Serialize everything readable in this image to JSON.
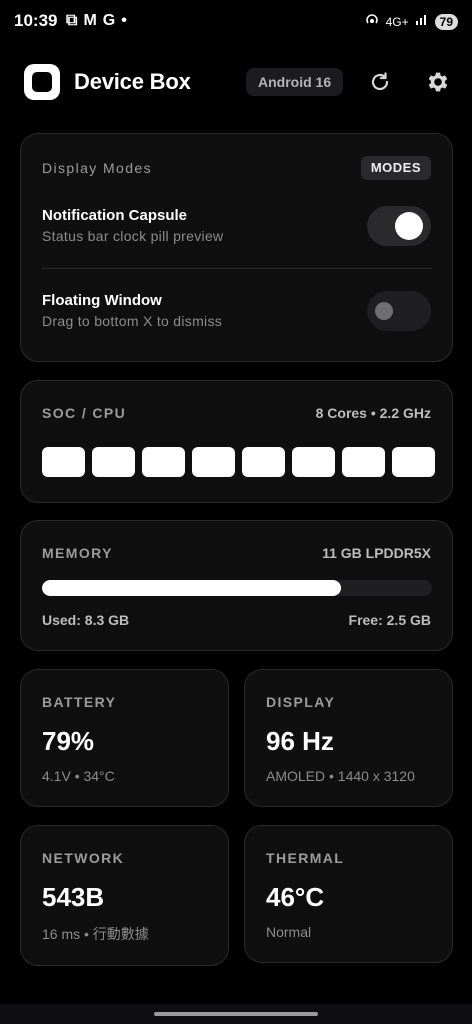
{
  "status_bar": {
    "time": "10:39",
    "left_glyphs": [
      "⧉",
      "M",
      "G",
      "•"
    ],
    "network_type": "4G+",
    "battery": "79"
  },
  "header": {
    "title": "Device Box",
    "version": "Android 16"
  },
  "display_modes": {
    "title": "Display Modes",
    "badge": "MODES",
    "items": [
      {
        "title": "Notification Capsule",
        "subtitle": "Status bar clock pill preview",
        "enabled": true
      },
      {
        "title": "Floating Window",
        "subtitle": "Drag to bottom X to dismiss",
        "enabled": false
      }
    ]
  },
  "soc": {
    "label": "SOC / CPU",
    "meta": "8 Cores • 2.2 GHz",
    "core_count": 8
  },
  "memory": {
    "label": "MEMORY",
    "meta": "11 GB LPDDR5X",
    "used": "Used: 8.3 GB",
    "free": "Free: 2.5 GB",
    "used_fraction": 0.767
  },
  "battery": {
    "label": "BATTERY",
    "value": "79%",
    "sub": "4.1V • 34°C"
  },
  "display": {
    "label": "DISPLAY",
    "value": "96 Hz",
    "sub": "AMOLED • 1440 x 3120"
  },
  "network": {
    "label": "NETWORK",
    "value": "543B",
    "sub": "16 ms • 行動數據"
  },
  "thermal": {
    "label": "THERMAL",
    "value": "46°C",
    "sub": "Normal"
  },
  "colors": {
    "background": "#000000",
    "card": "#0f0f10",
    "accent": "#ffffff"
  }
}
